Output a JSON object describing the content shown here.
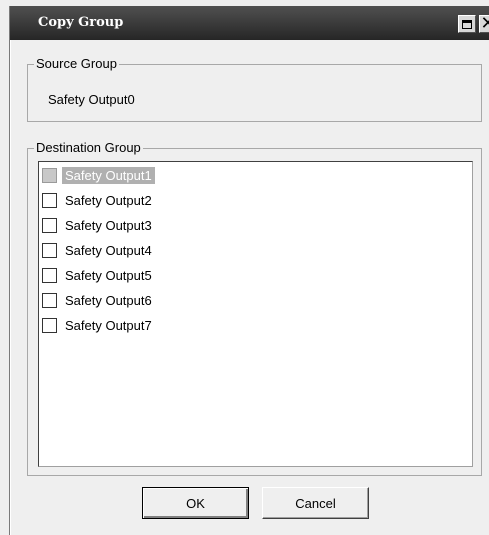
{
  "window": {
    "title": "Copy Group",
    "maximize_icon": "maximize-icon",
    "close_icon": "close-icon"
  },
  "source_group": {
    "legend": "Source Group",
    "value": "Safety Output0"
  },
  "destination_group": {
    "legend": "Destination Group",
    "items": [
      {
        "label": "Safety Output1",
        "checked": false,
        "selected": true
      },
      {
        "label": "Safety Output2",
        "checked": false,
        "selected": false
      },
      {
        "label": "Safety Output3",
        "checked": false,
        "selected": false
      },
      {
        "label": "Safety Output4",
        "checked": false,
        "selected": false
      },
      {
        "label": "Safety Output5",
        "checked": false,
        "selected": false
      },
      {
        "label": "Safety Output6",
        "checked": false,
        "selected": false
      },
      {
        "label": "Safety Output7",
        "checked": false,
        "selected": false
      }
    ]
  },
  "buttons": {
    "ok": "OK",
    "cancel": "Cancel"
  }
}
